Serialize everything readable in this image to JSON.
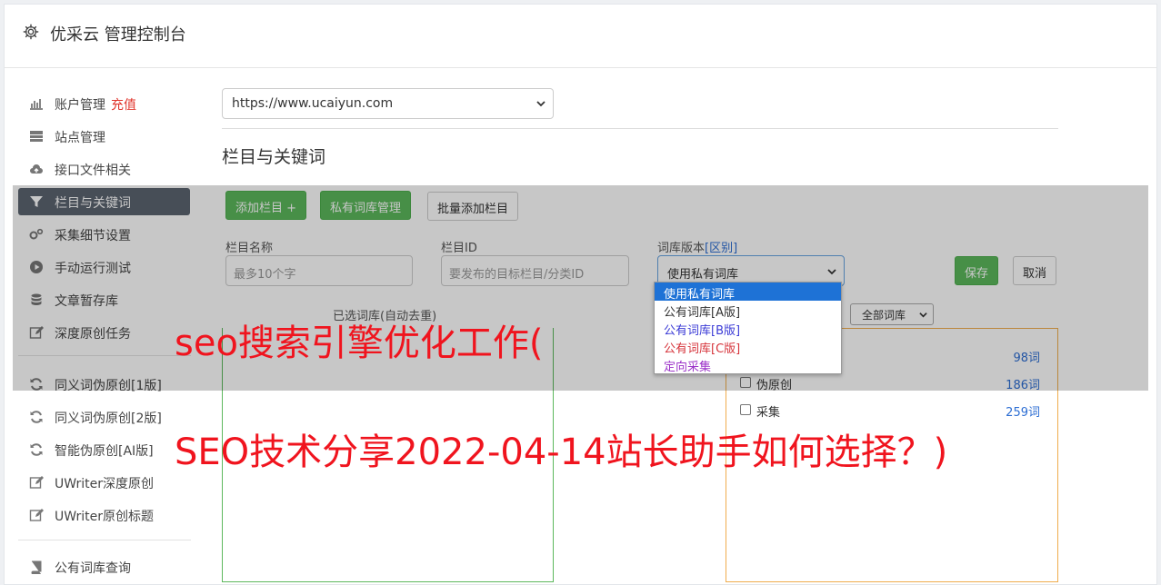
{
  "header": {
    "title": "优采云 管理控制台",
    "icon": "gear-icon"
  },
  "sidebar": {
    "items": [
      {
        "label": "账户管理",
        "badge": "充值",
        "icon": "bar-chart-icon"
      },
      {
        "label": "站点管理",
        "icon": "server-icon"
      },
      {
        "label": "接口文件相关",
        "icon": "cloud-upload-icon"
      },
      {
        "label": "栏目与关键词",
        "icon": "filter-icon",
        "active": true
      },
      {
        "label": "采集细节设置",
        "icon": "gears-icon"
      },
      {
        "label": "手动运行测试",
        "icon": "play-circle-icon"
      },
      {
        "label": "文章暂存库",
        "icon": "database-icon"
      },
      {
        "label": "深度原创任务",
        "icon": "edit-icon"
      },
      {
        "label": "同义词伪原创[1版]",
        "icon": "refresh-icon"
      },
      {
        "label": "同义词伪原创[2版]",
        "icon": "refresh-icon"
      },
      {
        "label": "智能伪原创[AI版]",
        "icon": "refresh-icon"
      },
      {
        "label": "UWriter深度原创",
        "icon": "edit-icon"
      },
      {
        "label": "UWriter原创标题",
        "icon": "edit-icon"
      },
      {
        "label": "公有词库查询",
        "icon": "book-icon"
      }
    ]
  },
  "main": {
    "site_select": "https://www.ucaiyun.com",
    "section_title": "栏目与关键词",
    "buttons": {
      "add_column": "添加栏目 +",
      "private_lib": "私有词库管理",
      "batch_add": "批量添加栏目",
      "save": "保存",
      "cancel": "取消"
    },
    "form": {
      "name_label": "栏目名称",
      "name_placeholder": "最多10个字",
      "id_label": "栏目ID",
      "id_placeholder": "要发布的目标栏目/分类ID",
      "version_label": "词库版本",
      "version_link": "[区别]",
      "version_selected": "使用私有词库",
      "version_options": [
        {
          "label": "使用私有词库",
          "color": "#ffffff"
        },
        {
          "label": "公有词库[A版]",
          "color": "#333333"
        },
        {
          "label": "公有词库[B版]",
          "color": "#3b3bd6"
        },
        {
          "label": "公有词库[C版]",
          "color": "#d6343b"
        },
        {
          "label": "定向采集",
          "color": "#9b32c8"
        }
      ]
    },
    "panel_caption": "已选词库(自动去重)",
    "lib_filter": "全部词库",
    "libraries": [
      {
        "name": "",
        "count": "98词"
      },
      {
        "name": "伪原创",
        "count": "186词"
      },
      {
        "name": "采集",
        "count": "259词"
      }
    ]
  },
  "overlay_text": {
    "line1": "seo搜索引擎优化工作(",
    "line2": "SEO技术分享2022-04-14站长助手如何选择？)"
  }
}
